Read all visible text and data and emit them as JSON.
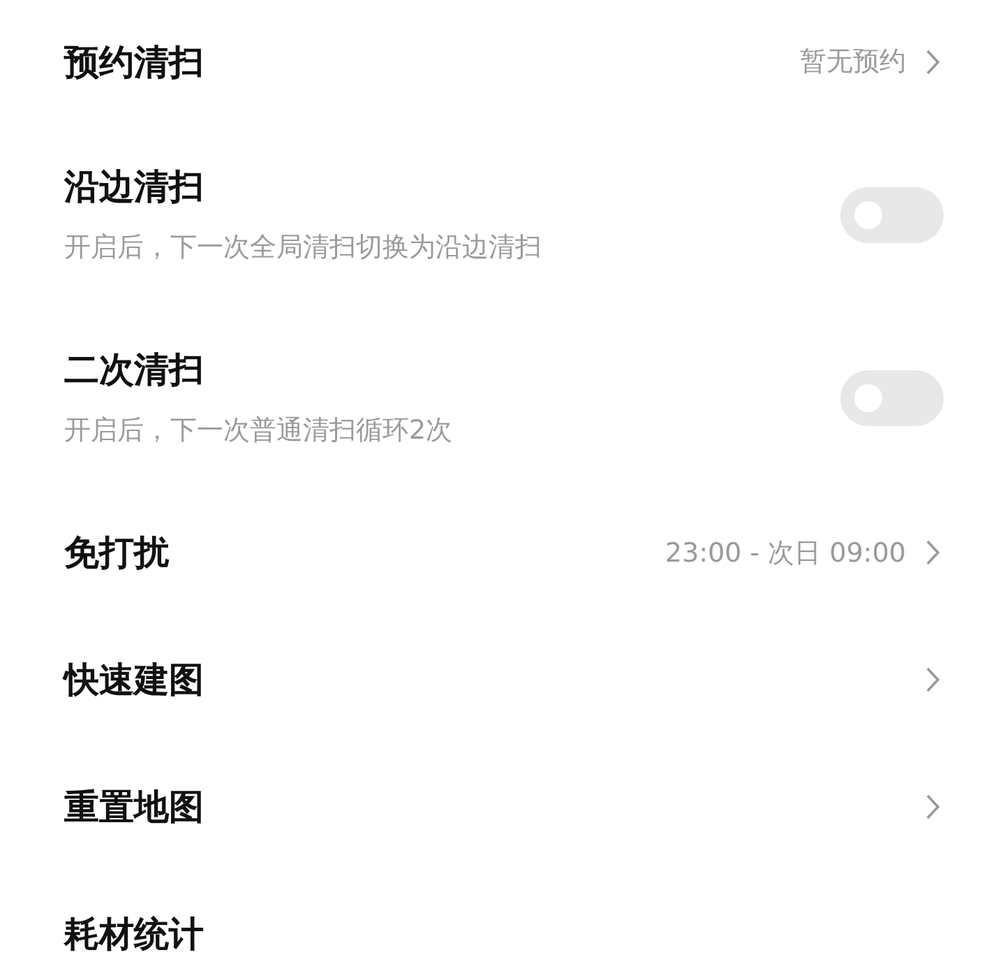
{
  "rows": [
    {
      "kind": "link",
      "title": "预约清扫",
      "value": "暂无预约",
      "chevron": true
    },
    {
      "kind": "toggle",
      "title": "沿边清扫",
      "subtitle": "开启后，下一次全局清扫切换为沿边清扫",
      "on": false
    },
    {
      "kind": "toggle",
      "title": "二次清扫",
      "subtitle": "开启后，下一次普通清扫循环2次",
      "on": false
    },
    {
      "kind": "link",
      "title": "免打扰",
      "value": "23:00 - 次日 09:00",
      "chevron": true
    },
    {
      "kind": "link",
      "title": "快速建图",
      "chevron": true
    },
    {
      "kind": "link",
      "title": "重置地图",
      "chevron": true
    },
    {
      "kind": "link",
      "title": "耗材统计",
      "chevron": false
    }
  ]
}
